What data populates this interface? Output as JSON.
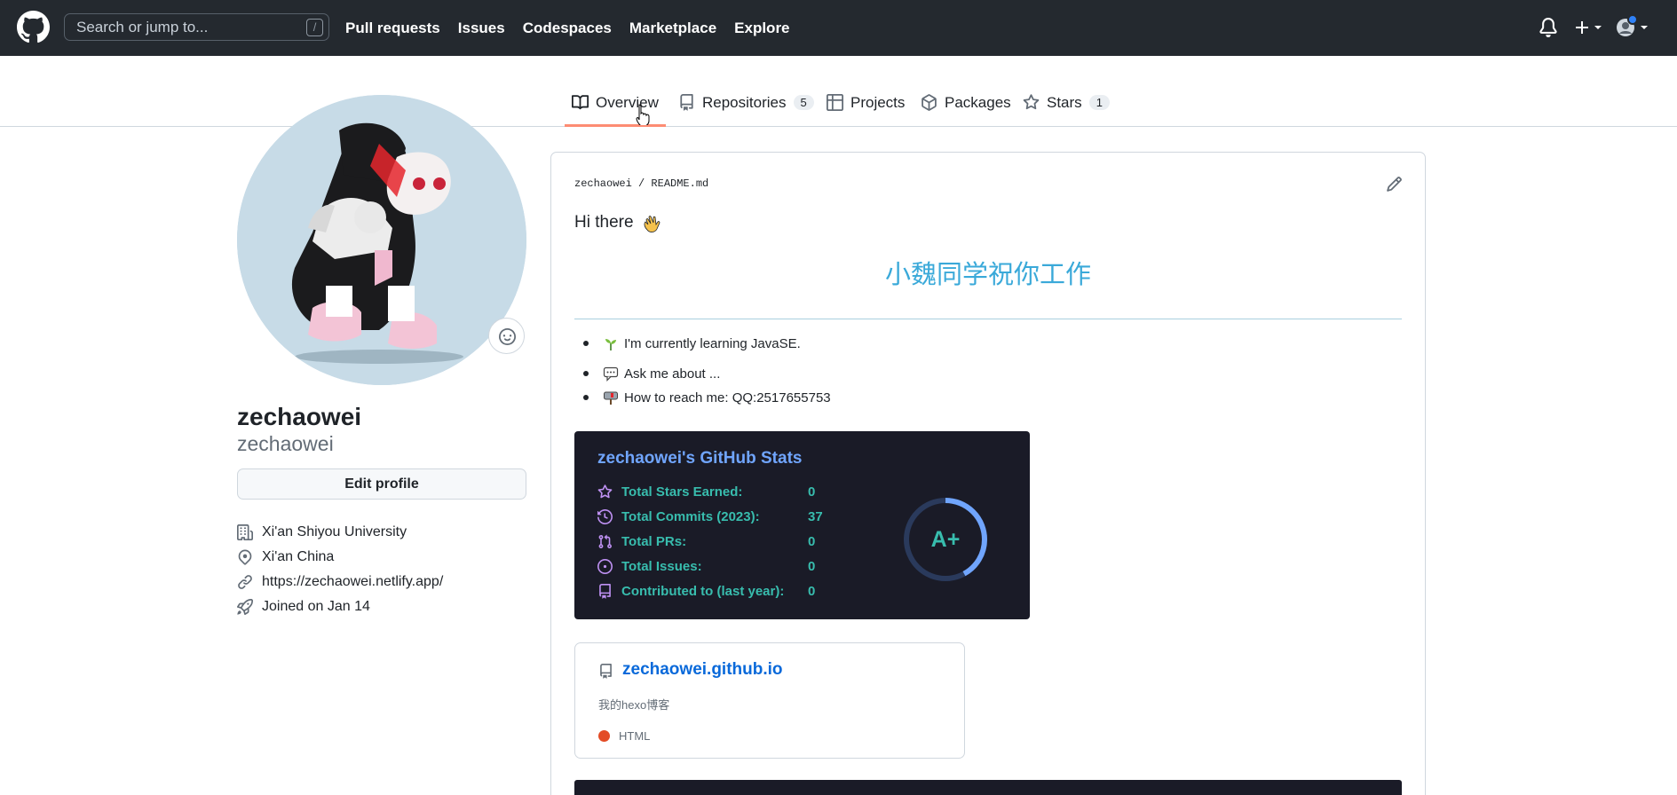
{
  "header": {
    "search_placeholder": "Search or jump to...",
    "search_shortcut": "/",
    "nav": [
      "Pull requests",
      "Issues",
      "Codespaces",
      "Marketplace",
      "Explore"
    ]
  },
  "tabs": [
    {
      "label": "Overview",
      "count": ""
    },
    {
      "label": "Repositories",
      "count": "5"
    },
    {
      "label": "Projects",
      "count": ""
    },
    {
      "label": "Packages",
      "count": ""
    },
    {
      "label": "Stars",
      "count": "1"
    }
  ],
  "profile": {
    "name": "zechaowei",
    "login": "zechaowei",
    "edit_label": "Edit profile",
    "organization": "Xi'an Shiyou University",
    "location": "Xi'an China",
    "website": "https://zechaowei.netlify.app/",
    "joined": "Joined on Jan 14"
  },
  "readme": {
    "owner": "zechaowei",
    "separator": "/",
    "file": "README.md",
    "greeting": "Hi there",
    "banner": "小魏同学祝你工作",
    "bullets": [
      "I'm currently learning JavaSE.",
      "Ask me about ...",
      "How to reach me: QQ:2517655753"
    ]
  },
  "stats": {
    "title": "zechaowei's GitHub Stats",
    "rows": [
      {
        "label": "Total Stars Earned:",
        "value": "0"
      },
      {
        "label": "Total Commits (2023):",
        "value": "37"
      },
      {
        "label": "Total PRs:",
        "value": "0"
      },
      {
        "label": "Total Issues:",
        "value": "0"
      },
      {
        "label": "Contributed to (last year):",
        "value": "0"
      }
    ],
    "grade": "A+",
    "ring_fill": 0.42
  },
  "pinned": {
    "name": "zechaowei.github.io",
    "description": "我的hexo博客",
    "language": "HTML",
    "language_color": "#e34c26"
  },
  "colors": {
    "header_bg": "#24292f",
    "tab_underline": "#fd8c73",
    "link": "#0969da",
    "stats_bg": "#1a1b27",
    "stats_title": "#70a5fd",
    "stats_text": "#38bdae",
    "stats_icon": "#bf91f3"
  }
}
